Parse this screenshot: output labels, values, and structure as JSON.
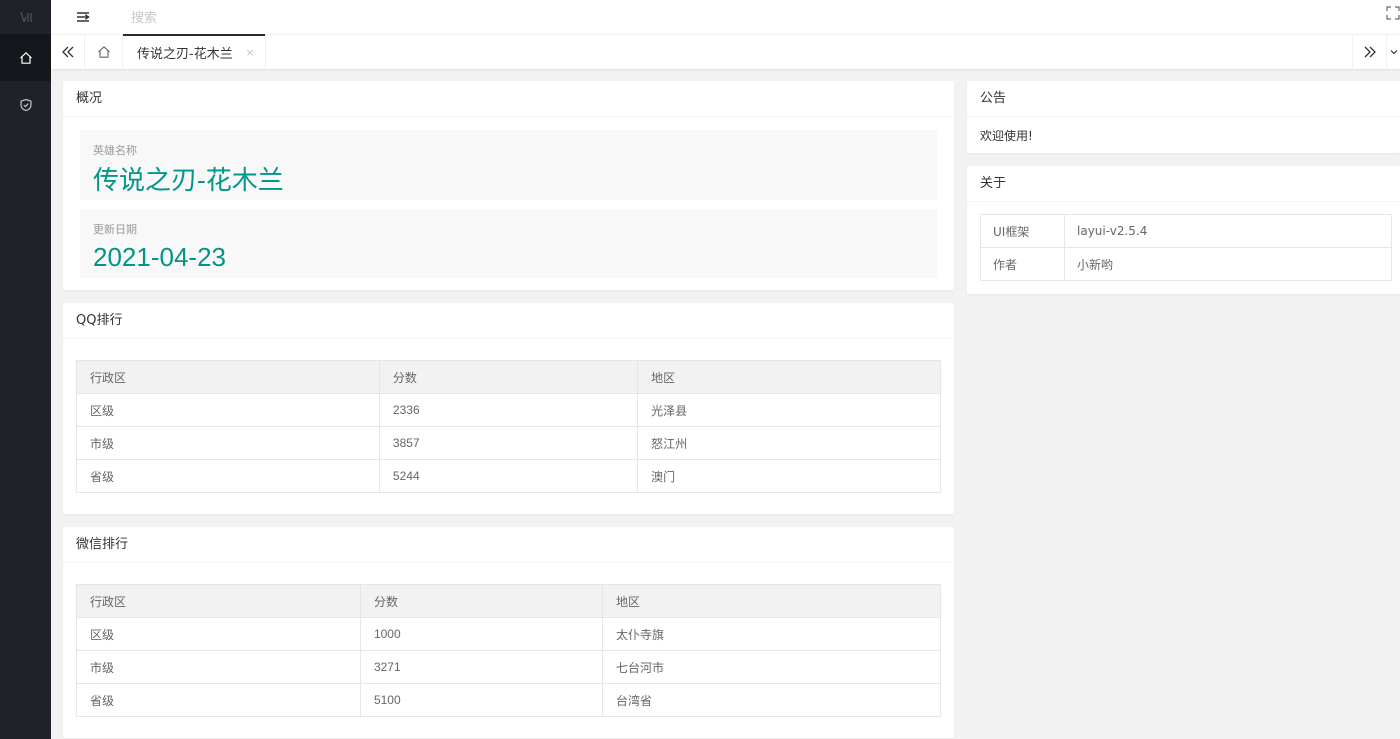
{
  "header": {
    "search_placeholder": "搜索"
  },
  "tabs": {
    "active_tab": "传说之刃-花木兰",
    "close_glyph": "×"
  },
  "overview": {
    "title": "概况",
    "hero_label": "英雄名称",
    "hero_value": "传说之刃-花木兰",
    "date_label": "更新日期",
    "date_value": "2021-04-23"
  },
  "qq_rank": {
    "title": "QQ排行",
    "columns": [
      "行政区",
      "分数",
      "地区"
    ],
    "rows": [
      [
        "区级",
        "2336",
        "光泽县"
      ],
      [
        "市级",
        "3857",
        "怒江州"
      ],
      [
        "省级",
        "5244",
        "澳门"
      ]
    ]
  },
  "wx_rank": {
    "title": "微信排行",
    "columns": [
      "行政区",
      "分数",
      "地区"
    ],
    "rows": [
      [
        "区级",
        "1000",
        "太仆寺旗"
      ],
      [
        "市级",
        "3271",
        "七台河市"
      ],
      [
        "省级",
        "5100",
        "台湾省"
      ]
    ]
  },
  "notice": {
    "title": "公告",
    "body": "欢迎使用!"
  },
  "about": {
    "title": "关于",
    "rows": [
      [
        "UI框架",
        "layui-v2.5.4"
      ],
      [
        "作者",
        "小新哟"
      ]
    ]
  },
  "colors": {
    "sidebar_bg": "#20222a",
    "accent": "#009688"
  },
  "icons": {
    "sidebar": [
      "home-icon",
      "shield-icon"
    ],
    "header": [
      "menu-toggle-icon",
      "fullscreen-icon"
    ],
    "tabs": [
      "double-left-icon",
      "home-icon",
      "double-right-icon",
      "chevron-down-icon"
    ]
  }
}
